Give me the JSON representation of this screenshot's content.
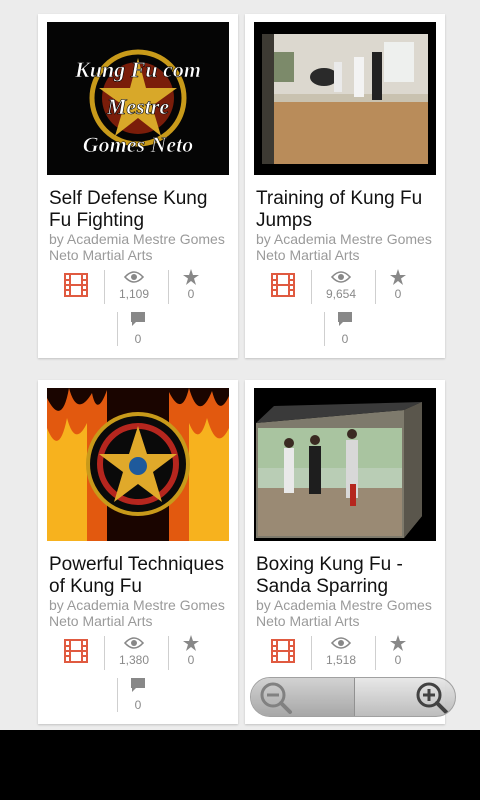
{
  "videos": [
    {
      "title": "Self Defense Kung Fu Fighting",
      "byline": "by Academia Mestre Gomes Neto Martial Arts",
      "views": "1,109",
      "stars": "0",
      "comments": "0",
      "thumb_text": [
        "Kung Fu com",
        "Mestre",
        "Gomes Neto"
      ]
    },
    {
      "title": "Training of Kung Fu Jumps",
      "byline": "by Academia Mestre Gomes Neto Martial Arts",
      "views": "9,654",
      "stars": "0",
      "comments": "0"
    },
    {
      "title": "Powerful Techniques of Kung Fu",
      "byline": "by Academia Mestre Gomes Neto Martial Arts",
      "views": "1,380",
      "stars": "0",
      "comments": "0"
    },
    {
      "title": "Boxing Kung Fu - Sanda Sparring",
      "byline": "by Academia Mestre Gomes Neto Martial Arts",
      "views": "1,518",
      "stars": "0"
    }
  ],
  "colors": {
    "film_icon": "#e05a40",
    "stat_icon": "#888888",
    "thumb_text": "#ffffff"
  },
  "icons": {
    "video": "film-icon",
    "views": "eye-icon",
    "stars": "star-icon",
    "comments": "comment-icon",
    "zoom_out": "zoom-out-icon",
    "zoom_in": "zoom-in-icon"
  }
}
